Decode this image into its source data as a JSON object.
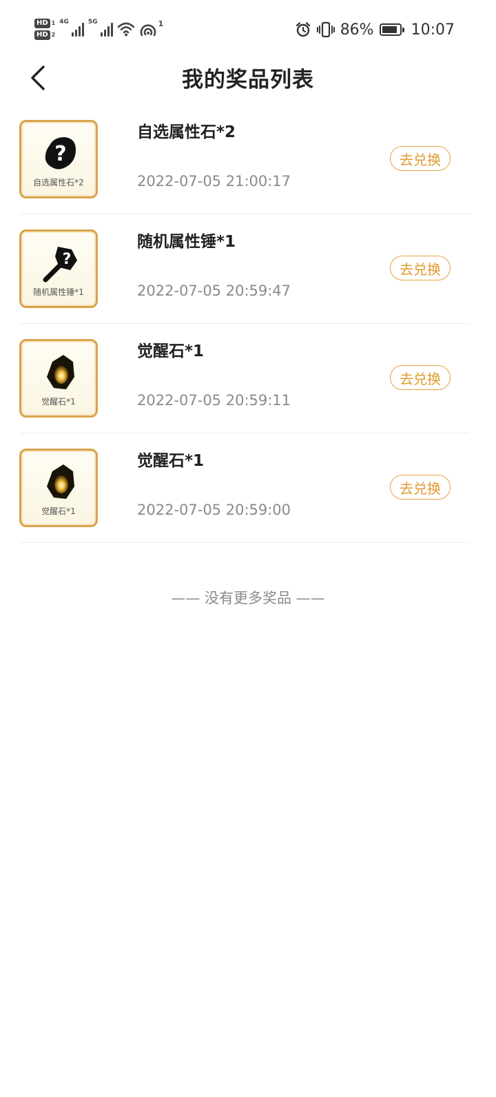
{
  "status_bar": {
    "hd1": "HD",
    "hd1_sub": "1",
    "hd2": "HD",
    "hd2_sub": "2",
    "net1": "4G",
    "net2": "5G",
    "hotspot_count": "1",
    "battery_percent": "86%",
    "battery_level": 0.86,
    "time": "10:07"
  },
  "header": {
    "title": "我的奖品列表"
  },
  "prizes": [
    {
      "name": "自选属性石*2",
      "thumb_label": "自选属性石*2",
      "icon": "mystery-stone-icon",
      "time": "2022-07-05 21:00:17",
      "action": "去兑换"
    },
    {
      "name": "随机属性锤*1",
      "thumb_label": "随机属性锤*1",
      "icon": "mystery-hammer-icon",
      "time": "2022-07-05 20:59:47",
      "action": "去兑换"
    },
    {
      "name": "觉醒石*1",
      "thumb_label": "觉醒石*1",
      "icon": "awakening-stone-icon",
      "time": "2022-07-05 20:59:11",
      "action": "去兑换"
    },
    {
      "name": "觉醒石*1",
      "thumb_label": "觉醒石*1",
      "icon": "awakening-stone-icon",
      "time": "2022-07-05 20:59:00",
      "action": "去兑换"
    }
  ],
  "end_note": "—— 没有更多奖品 ——",
  "colors": {
    "accent": "#e09a30",
    "thumb_border": "#d9a34a",
    "time_text": "#8a8a8a"
  }
}
